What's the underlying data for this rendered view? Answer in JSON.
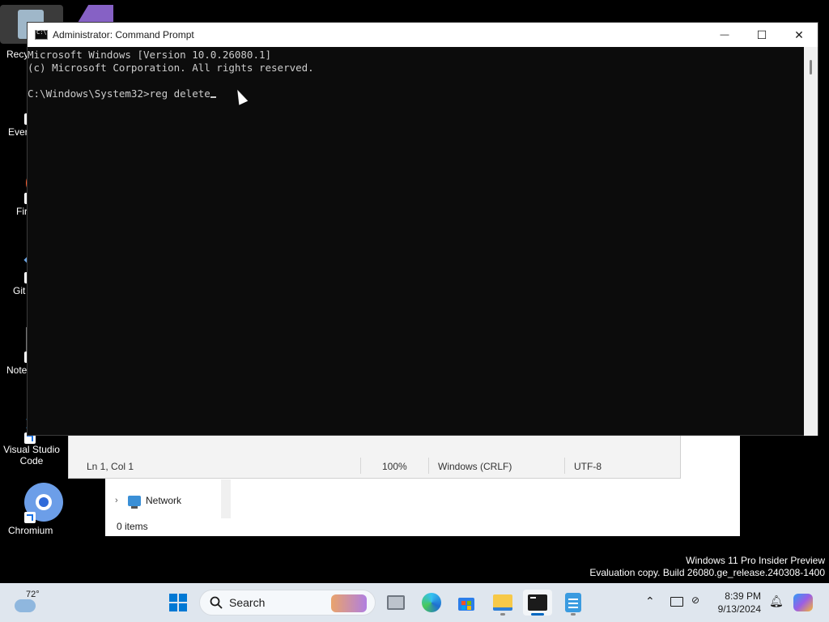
{
  "desktop": {
    "icons": [
      {
        "label": "Recy",
        "icon": "recycle-bin-icon"
      },
      {
        "label": "Ever",
        "icon": "everything-icon"
      },
      {
        "label": "Fir",
        "icon": "firefox-icon"
      },
      {
        "label": "Git",
        "icon": "git-icon"
      },
      {
        "label": "Note",
        "icon": "notepad-plus-plus-icon"
      },
      {
        "label": "Visual Studio Code",
        "icon": "vscode-icon"
      },
      {
        "label": "Chromium",
        "icon": "chromium-icon"
      }
    ]
  },
  "cmd": {
    "title": "Administrator: Command Prompt",
    "lines": [
      "Microsoft Windows [Version 10.0.26080.1]",
      "(c) Microsoft Corporation. All rights reserved.",
      "",
      "C:\\Windows\\System32>reg delete"
    ],
    "buttons": {
      "minimize": "—",
      "maximize": "☐",
      "close": "✕"
    }
  },
  "notepad": {
    "position": "Ln 1, Col 1",
    "zoom": "100%",
    "line_ending": "Windows (CRLF)",
    "encoding": "UTF-8"
  },
  "explorer": {
    "nav_item": "Network",
    "status": "0 items"
  },
  "watermark": {
    "line1": "Windows 11 Pro Insider Preview",
    "line2": "Evaluation copy. Build 26080.ge_release.240308-1400"
  },
  "taskbar": {
    "weather_temp": "72°",
    "search_label": "Search",
    "apps": [
      "start-icon",
      "task-view-icon",
      "edge-icon",
      "store-icon",
      "file-explorer-icon",
      "terminal-icon",
      "notepad-icon"
    ],
    "clock_time": "8:39 PM",
    "clock_date": "9/13/2024",
    "colors": {
      "accent": "#0067c0",
      "taskbar_bg": "#dfe6ee"
    }
  }
}
